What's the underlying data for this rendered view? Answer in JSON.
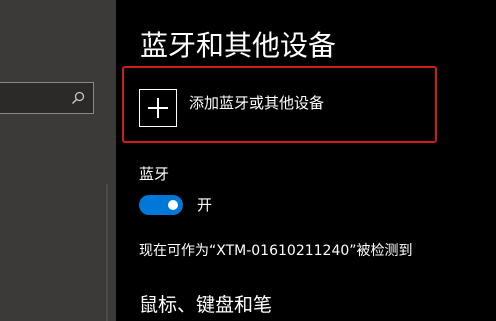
{
  "sidebar": {
    "search": {
      "icon": "search-icon",
      "value": ""
    }
  },
  "main": {
    "page_title": "蓝牙和其他设备",
    "add_device": {
      "icon": "plus-icon",
      "label": "添加蓝牙或其他设备"
    },
    "bluetooth": {
      "section_label": "蓝牙",
      "toggle_on": true,
      "toggle_state_label": "开"
    },
    "discoverable_text": "现在可作为“XTM-01610211240”被检测到",
    "next_section_heading": "鼠标、键盘和笔"
  },
  "colors": {
    "accent": "#0078d7",
    "highlight_border": "#d21c1c",
    "content_background": "#000000",
    "sidebar_background": "#3b3a39"
  }
}
